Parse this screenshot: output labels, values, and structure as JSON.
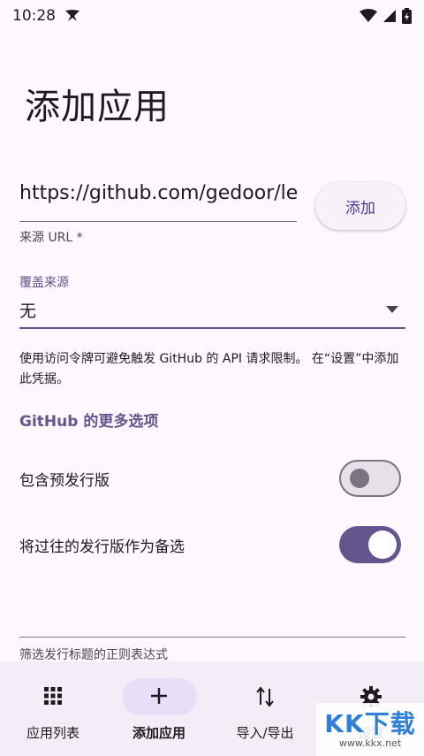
{
  "status_bar": {
    "time": "10:28"
  },
  "page": {
    "title": "添加应用"
  },
  "source_url": {
    "value": "https://github.com/gedoor/le",
    "label": "来源 URL *"
  },
  "add_button": {
    "label": "添加"
  },
  "override_source": {
    "label": "覆盖来源",
    "value": "无"
  },
  "help_text": "使用访问令牌可避免触发 GitHub 的 API 请求限制。 在“设置”中添加此凭据。",
  "github_section": {
    "heading": "GitHub 的更多选项",
    "include_prerelease": {
      "label": "包含预发行版",
      "on": false
    },
    "fallback_older": {
      "label": "将过往的发行版作为备选",
      "on": true
    }
  },
  "filter": {
    "label": "筛选发行标题的正则表达式"
  },
  "bottom_nav": {
    "items": [
      {
        "label": "应用列表",
        "icon": "grid-icon"
      },
      {
        "label": "添加应用",
        "icon": "plus-icon",
        "active": true
      },
      {
        "label": "导入/导出",
        "icon": "swap-vertical-icon"
      },
      {
        "label": "设置",
        "icon": "gear-icon"
      }
    ]
  },
  "watermark": {
    "logo": "KK下载",
    "url": "www.kkx.net"
  },
  "colors": {
    "primary": "#65558f",
    "background": "#fdf7fe",
    "nav_background": "#f3edf7",
    "nav_indicator": "#e8def8"
  }
}
